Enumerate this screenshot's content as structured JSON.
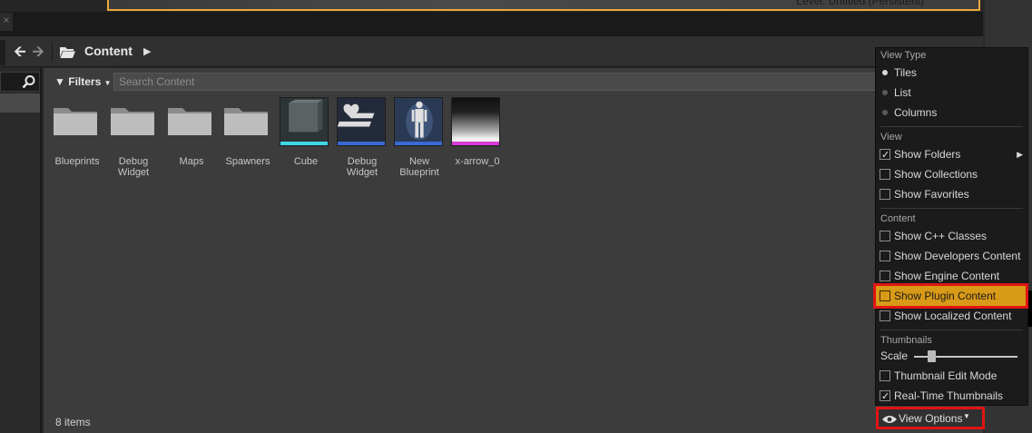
{
  "viewport": {
    "overlay_text": "Level: Untitled (Persistent)"
  },
  "nav": {
    "back_icon": "arrow-left-icon",
    "forward_icon": "arrow-right-icon",
    "breadcrumb": "Content"
  },
  "toolbar": {
    "filters_label": "Filters",
    "search_placeholder": "Search Content"
  },
  "assets": [
    {
      "label": "Blueprints",
      "kind": "folder"
    },
    {
      "label": "Debug Widget",
      "kind": "folder"
    },
    {
      "label": "Maps",
      "kind": "folder"
    },
    {
      "label": "Spawners",
      "kind": "folder"
    },
    {
      "label": "Cube",
      "kind": "static-mesh",
      "bar_color": "#3fd6e6"
    },
    {
      "label": "Debug Widget",
      "kind": "widget-blueprint",
      "bar_color": "#3a6ad6"
    },
    {
      "label": "New Blueprint",
      "kind": "blueprint",
      "bar_color": "#3a6ad6"
    },
    {
      "label": "x-arrow_0",
      "kind": "texture",
      "bar_color": "#d83ad6"
    }
  ],
  "status": {
    "items_count": "8 items"
  },
  "view_options_menu": {
    "view_type_header": "View Type",
    "view_type": [
      {
        "label": "Tiles",
        "selected": true
      },
      {
        "label": "List",
        "selected": false
      },
      {
        "label": "Columns",
        "selected": false
      }
    ],
    "view_header": "View",
    "view": [
      {
        "label": "Show Folders",
        "checked": true,
        "submenu": true
      },
      {
        "label": "Show Collections",
        "checked": false
      },
      {
        "label": "Show Favorites",
        "checked": false
      }
    ],
    "content_header": "Content",
    "content": [
      {
        "label": "Show C++ Classes",
        "checked": false
      },
      {
        "label": "Show Developers Content",
        "checked": false
      },
      {
        "label": "Show Engine Content",
        "checked": false
      },
      {
        "label": "Show Plugin Content",
        "checked": false,
        "highlighted": true
      },
      {
        "label": "Show Localized Content",
        "checked": false
      }
    ],
    "thumbnails_header": "Thumbnails",
    "scale_label": "Scale",
    "scale_value": 0.17,
    "thumbnails": [
      {
        "label": "Thumbnail Edit Mode",
        "checked": false
      },
      {
        "label": "Real-Time Thumbnails",
        "checked": true
      }
    ]
  },
  "view_options_button": {
    "label": "View Options",
    "icon": "eye-icon"
  },
  "colors": {
    "highlight": "#d99a17",
    "annotation_red": "#e01414"
  }
}
